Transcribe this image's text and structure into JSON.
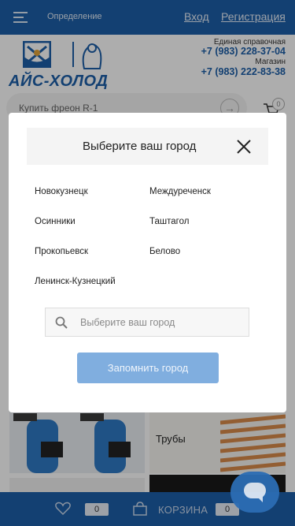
{
  "topbar": {
    "city_link": "Определение",
    "login": "Вход",
    "register": "Регистрация"
  },
  "header": {
    "logo_text": "АЙС-ХОЛОД",
    "phone1_label": "Единая справочная",
    "phone1": "+7 (983) 228-37-04",
    "phone2_label": "Магазин",
    "phone2": "+7 (983) 222-83-38"
  },
  "search": {
    "placeholder": "Купить фреон R-1",
    "cart_count": "0"
  },
  "products": {
    "pipes_label": "Трубы"
  },
  "modal": {
    "title": "Выберите ваш город",
    "cities": [
      "Новокузнецк",
      "Междуреченск",
      "Осинники",
      "Таштагол",
      "Прокопьевск",
      "Белово",
      "Ленинск-Кузнецкий"
    ],
    "search_placeholder": "Выберите ваш город",
    "remember_button": "Запомнить город"
  },
  "bottombar": {
    "favorites_count": "0",
    "cart_label": "КОРЗИНА",
    "cart_count": "0"
  },
  "colors": {
    "brand": "#1d5fa8",
    "button": "#80aedf"
  }
}
